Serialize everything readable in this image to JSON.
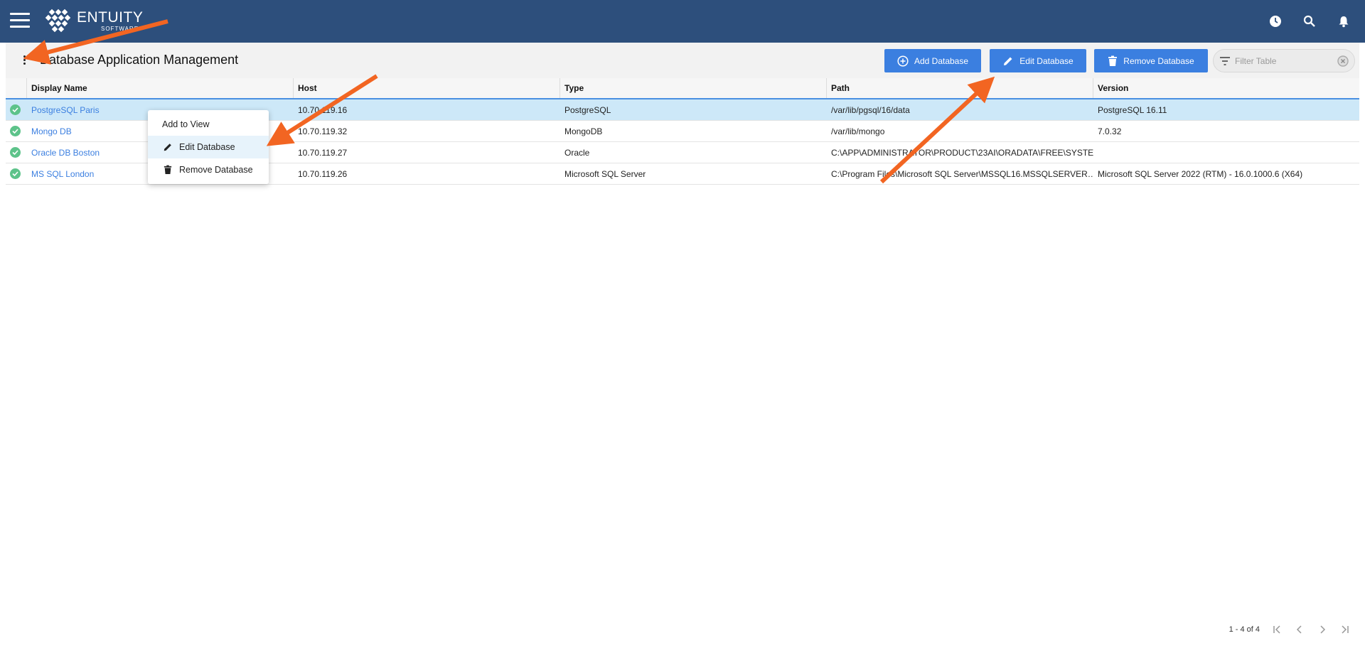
{
  "app": {
    "brand_name": "ENTUITY",
    "brand_sub": "SOFTWARE™"
  },
  "icons": {
    "menu": "hamburger-icon",
    "clock": "clock-icon",
    "search": "search-icon",
    "bell": "bell-icon",
    "kebab": "more-vertical-icon",
    "add": "plus-circle-icon",
    "edit": "pencil-icon",
    "remove": "trash-icon",
    "filter": "filter-icon",
    "clear": "clear-circle-icon",
    "status": "check-circle-icon"
  },
  "colors": {
    "topbar": "#2d4f7c",
    "accent": "#3b7fe0",
    "selected_row": "#cde8f8",
    "status_ok": "#5dc38a",
    "arrow": "#f26522"
  },
  "page": {
    "title": "Database Application Management"
  },
  "toolbar": {
    "add_label": "Add Database",
    "edit_label": "Edit Database",
    "remove_label": "Remove Database",
    "filter_placeholder": "Filter Table"
  },
  "table": {
    "columns": [
      "Display Name",
      "Host",
      "Type",
      "Path",
      "Version"
    ],
    "rows": [
      {
        "name": "PostgreSQL Paris",
        "host": "10.70.119.16",
        "type": "PostgreSQL",
        "path": "/var/lib/pgsql/16/data",
        "version": "PostgreSQL 16.11",
        "selected": true
      },
      {
        "name": "Mongo DB",
        "host": "10.70.119.32",
        "type": "MongoDB",
        "path": "/var/lib/mongo",
        "version": "7.0.32",
        "selected": false
      },
      {
        "name": "Oracle DB Boston",
        "host": "10.70.119.27",
        "type": "Oracle",
        "path": "C:\\APP\\ADMINISTRATOR\\PRODUCT\\23AI\\ORADATA\\FREE\\SYSTE…",
        "version": "",
        "selected": false
      },
      {
        "name": "MS SQL London",
        "host": "10.70.119.26",
        "type": "Microsoft SQL Server",
        "path": "C:\\Program Files\\Microsoft SQL Server\\MSSQL16.MSSQLSERVER…",
        "version": "Microsoft SQL Server 2022 (RTM) - 16.0.1000.6 (X64)",
        "selected": false
      }
    ]
  },
  "context_menu": {
    "items": [
      {
        "label": "Add to View",
        "icon": ""
      },
      {
        "label": "Edit Database",
        "icon": "pencil-icon"
      },
      {
        "label": "Remove Database",
        "icon": "trash-icon"
      }
    ]
  },
  "pagination": {
    "range": "1 - 4 of 4"
  }
}
